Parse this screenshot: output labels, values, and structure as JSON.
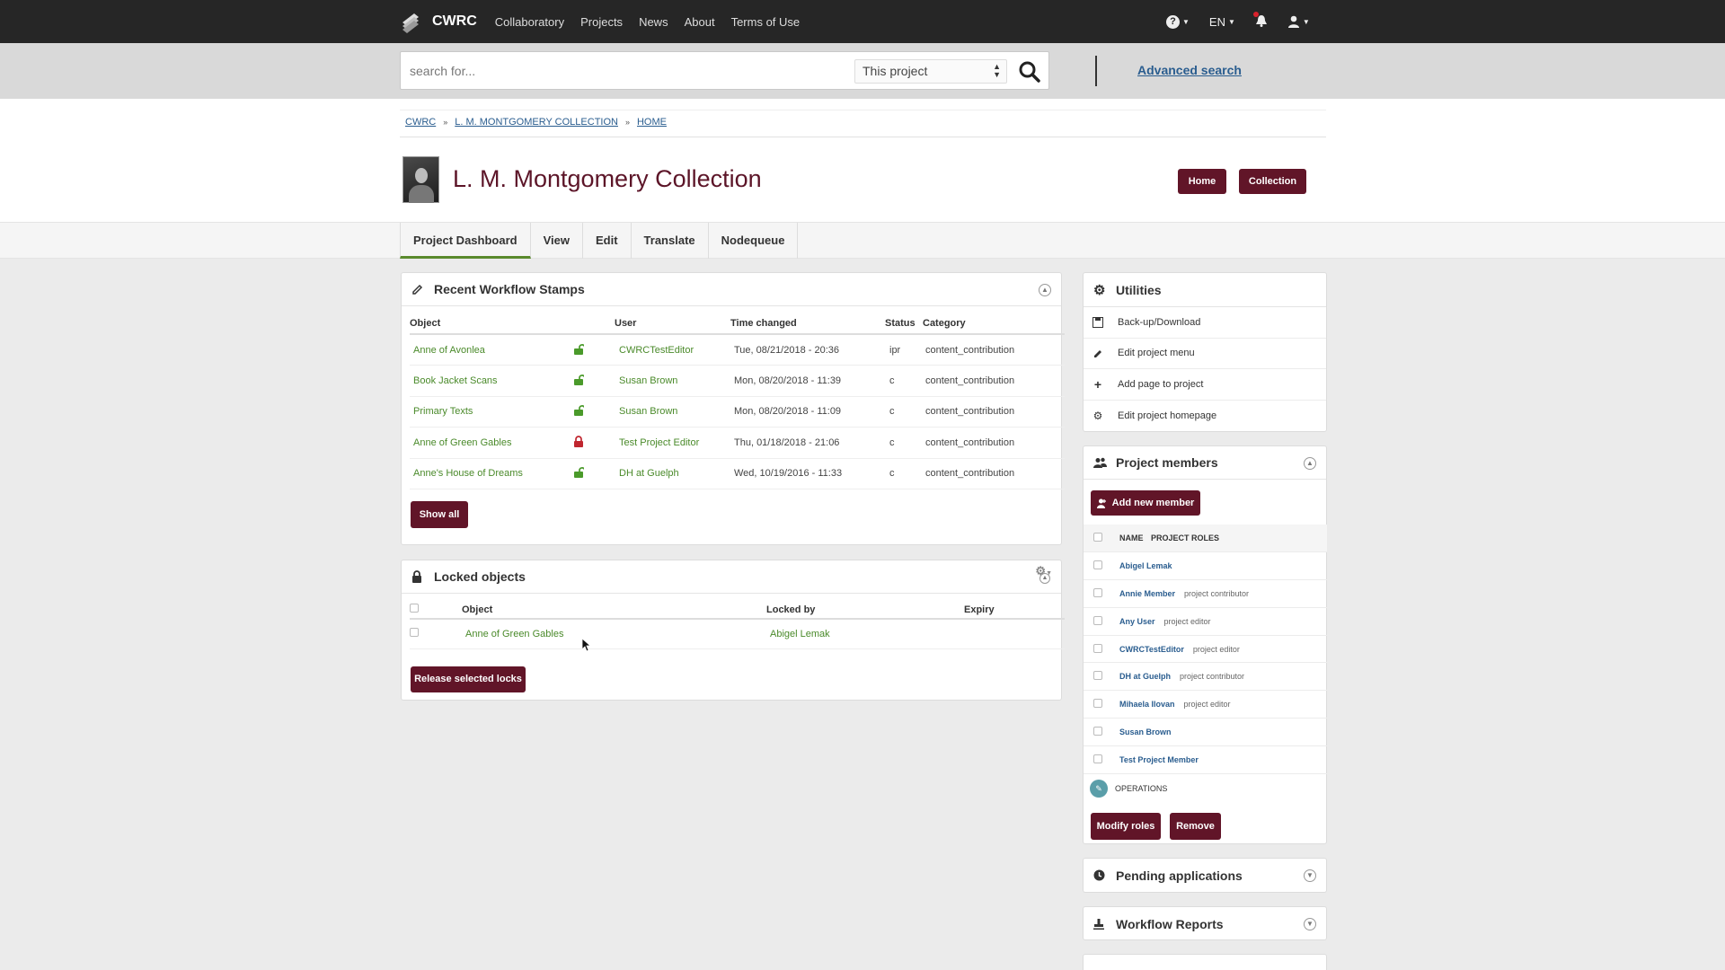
{
  "navbar": {
    "brand": "CWRC",
    "items": [
      "Collaboratory",
      "Projects",
      "News",
      "About",
      "Terms of Use"
    ],
    "lang": "EN"
  },
  "search": {
    "placeholder": "search for...",
    "scope": "This project",
    "advanced": "Advanced search"
  },
  "breadcrumb": [
    "CWRC",
    "L. M. MONTGOMERY COLLECTION",
    "HOME"
  ],
  "page": {
    "title": "L. M. Montgomery Collection",
    "btn_home": "Home",
    "btn_collection": "Collection"
  },
  "tabs": [
    "Project Dashboard",
    "View",
    "Edit",
    "Translate",
    "Nodequeue"
  ],
  "workflow": {
    "title": "Recent Workflow Stamps",
    "headers": [
      "Object",
      "User",
      "Time changed",
      "Status",
      "Category"
    ],
    "rows": [
      {
        "object": "Anne of Avonlea",
        "lock": "unlocked",
        "user": "CWRCTestEditor",
        "time": "Tue, 08/21/2018 - 20:36",
        "status": "ipr",
        "category": "content_contribution"
      },
      {
        "object": "Book Jacket Scans",
        "lock": "unlocked",
        "user": "Susan Brown",
        "time": "Mon, 08/20/2018 - 11:39",
        "status": "c",
        "category": "content_contribution"
      },
      {
        "object": "Primary Texts",
        "lock": "unlocked",
        "user": "Susan Brown",
        "time": "Mon, 08/20/2018 - 11:09",
        "status": "c",
        "category": "content_contribution"
      },
      {
        "object": "Anne of Green Gables",
        "lock": "locked",
        "user": "Test Project Editor",
        "time": "Thu, 01/18/2018 - 21:06",
        "status": "c",
        "category": "content_contribution"
      },
      {
        "object": "Anne's House of Dreams",
        "lock": "unlocked",
        "user": "DH at Guelph",
        "time": "Wed, 10/19/2016 - 11:33",
        "status": "c",
        "category": "content_contribution"
      }
    ],
    "show_all": "Show all"
  },
  "locked": {
    "title": "Locked objects",
    "headers": [
      "Object",
      "Locked by",
      "Expiry"
    ],
    "rows": [
      {
        "object": "Anne of Green Gables",
        "locked_by": "Abigel Lemak",
        "expiry": ""
      }
    ],
    "release": "Release selected locks"
  },
  "utilities": {
    "title": "Utilities",
    "items": [
      {
        "label": "Back-up/Download",
        "icon": "save-icon"
      },
      {
        "label": "Edit project menu",
        "icon": "pencil-icon"
      },
      {
        "label": "Add page to project",
        "icon": "plus-icon"
      },
      {
        "label": "Edit project homepage",
        "icon": "gear-icon"
      }
    ]
  },
  "members": {
    "title": "Project members",
    "add": "Add new member",
    "headers": [
      "NAME",
      "PROJECT ROLES"
    ],
    "rows": [
      {
        "name": "Abigel Lemak",
        "role": ""
      },
      {
        "name": "Annie Member",
        "role": "project contributor"
      },
      {
        "name": "Any User",
        "role": "project editor"
      },
      {
        "name": "CWRCTestEditor",
        "role": "project editor"
      },
      {
        "name": "DH at Guelph",
        "role": "project contributor"
      },
      {
        "name": "Mihaela Ilovan",
        "role": "project editor"
      },
      {
        "name": "Susan Brown",
        "role": ""
      },
      {
        "name": "Test Project Member",
        "role": ""
      }
    ],
    "operations": "OPERATIONS",
    "modify": "Modify roles",
    "remove": "Remove"
  },
  "pending": {
    "title": "Pending applications"
  },
  "reports": {
    "title": "Workflow Reports"
  },
  "colors": {
    "accent": "#611528",
    "link_green": "#4a8a2a",
    "link_blue": "#2a5d8f",
    "navbar": "#262626"
  }
}
